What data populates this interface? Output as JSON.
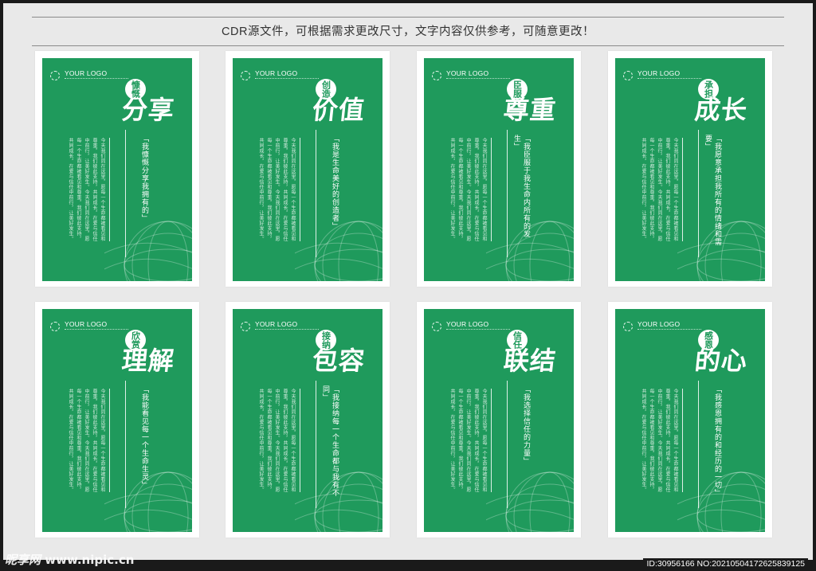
{
  "header": {
    "text": "CDR源文件，可根据需求更改尺寸，文字内容仅供参考，可随意更改！"
  },
  "logo_text": "YOUR LOGO",
  "cards": [
    {
      "small": "慷慨",
      "big": "分享",
      "quote": "「我慷慨分享我拥有的」"
    },
    {
      "small": "创造",
      "big": "价值",
      "quote": "「我是生命美好的创造者」"
    },
    {
      "small": "臣服",
      "big": "尊重",
      "quote": "「我臣服于我生命内所有的发生」"
    },
    {
      "small": "承担",
      "big": "成长",
      "quote": "「我愿意承担我所有的情绪和需要」"
    },
    {
      "small": "欣赏",
      "big": "理解",
      "quote": "「我能看见每一个生命生灵」"
    },
    {
      "small": "接纳",
      "big": "包容",
      "quote": "「我接纳每一个生命都与我有不同」"
    },
    {
      "small": "信任",
      "big": "联结",
      "quote": "「我选择信任的力量」"
    },
    {
      "small": "感恩",
      "big": "的心",
      "quote": "「我感恩拥有的和经历的一切」"
    }
  ],
  "footer": {
    "watermark_brand": "昵享网",
    "watermark_url": "www.nipic.cn",
    "id_text": "ID:30956166 NO:20210504172625839125"
  }
}
